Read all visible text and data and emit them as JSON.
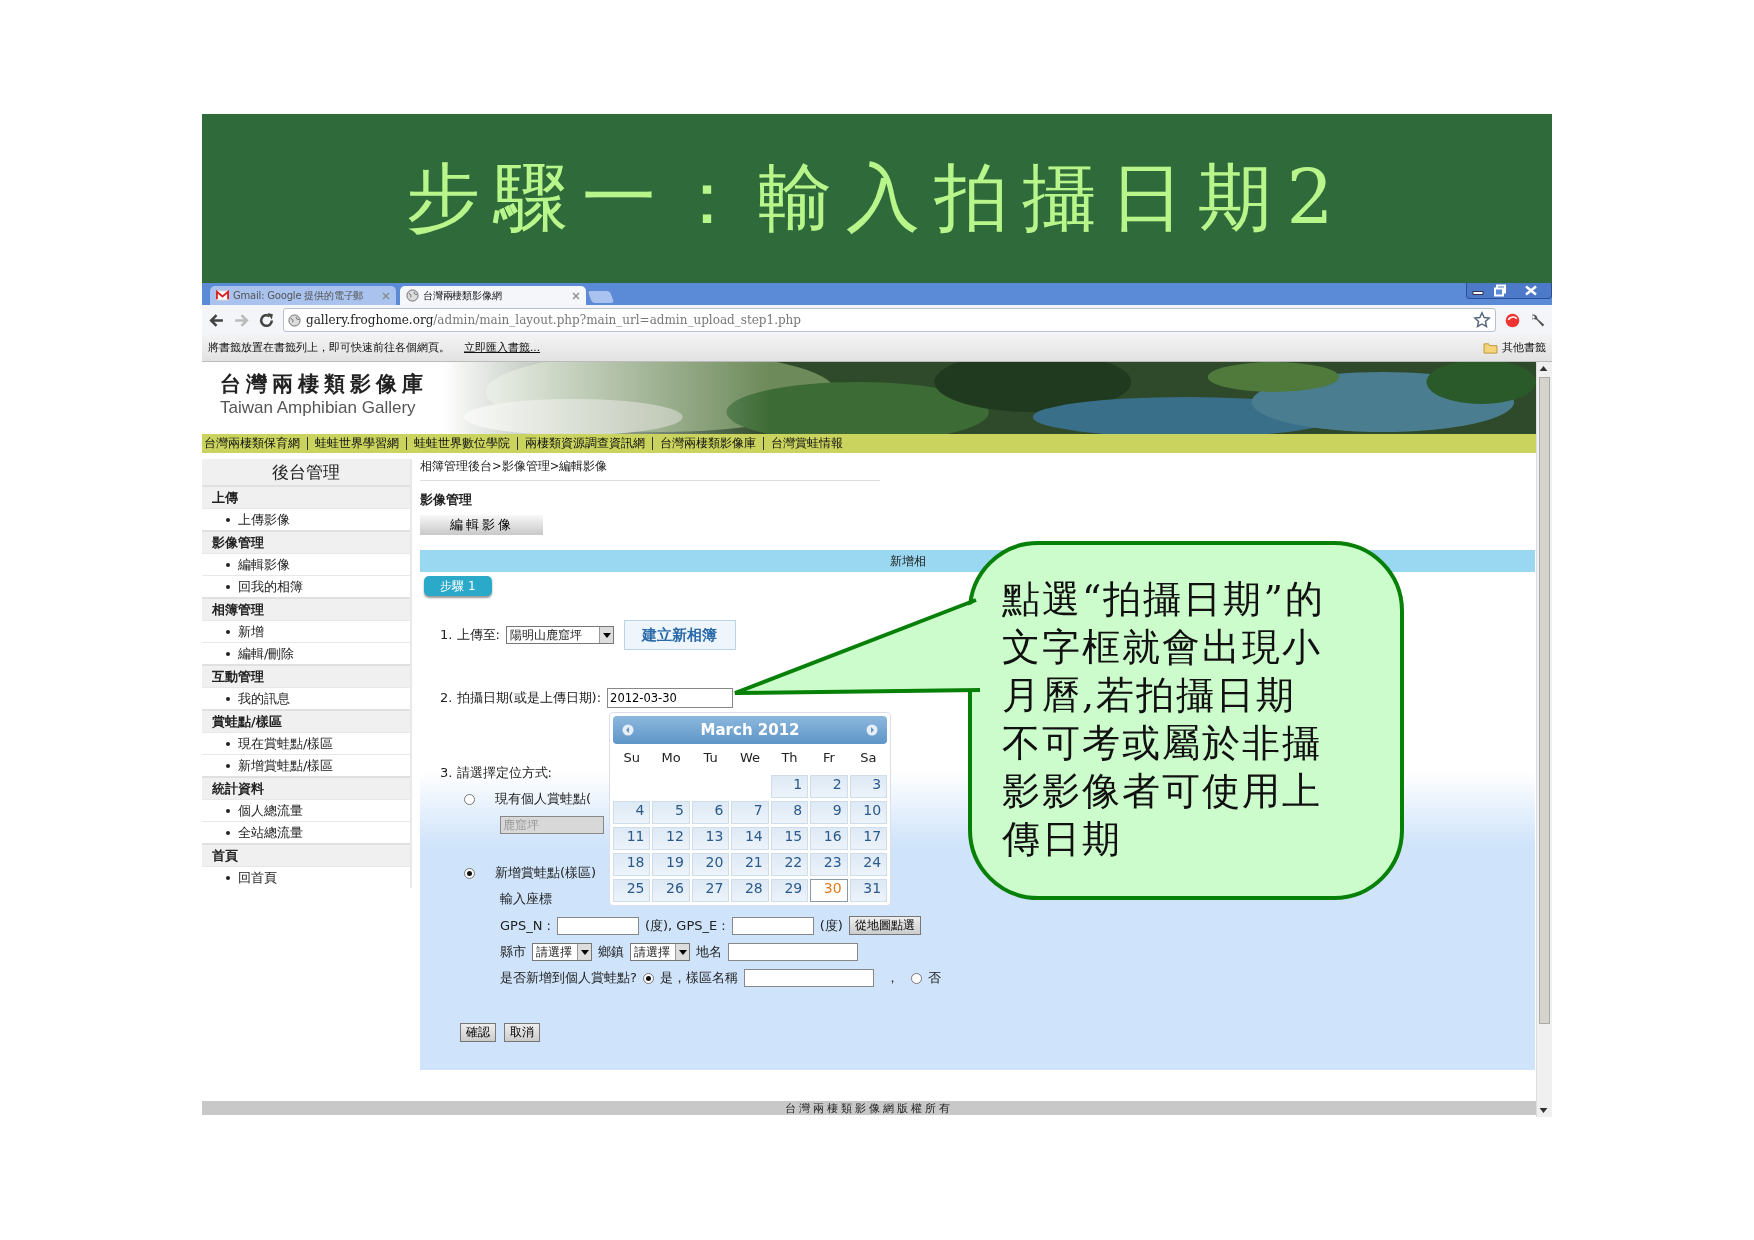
{
  "slide_title": "步驟一：輸入拍攝日期2",
  "browser": {
    "tabs": [
      {
        "title": "Gmail: Google 提供的電子郵",
        "kind": "mail",
        "selected": false
      },
      {
        "title": "台灣兩棲類影像網",
        "kind": "globe",
        "selected": true
      }
    ],
    "url_host": "gallery.froghome.org",
    "url_path": "/admin/main_layout.php?main_url=admin_upload_step1.php",
    "bookmark_prompt": "將書籤放置在書籤列上，即可快速前往各個網頁。",
    "bookmark_link": "立即匯入書籤...",
    "other_bookmarks": "其他書籤"
  },
  "site": {
    "title_zh": "台灣兩棲類影像庫",
    "title_en": "Taiwan Amphibian Gallery",
    "links": [
      "台灣兩棲類保育網",
      "蛙蛙世界學習網",
      "蛙蛙世界數位學院",
      "兩棲類資源調查資訊網",
      "台灣兩棲類影像庫",
      "台灣賞蛙情報"
    ]
  },
  "sidebar": {
    "title": "後台管理",
    "sections": [
      {
        "heading": "上傳",
        "items": [
          "上傳影像"
        ]
      },
      {
        "heading": "影像管理",
        "items": [
          "編輯影像",
          "回我的相簿"
        ]
      },
      {
        "heading": "相簿管理",
        "items": [
          "新增",
          "編輯/刪除"
        ]
      },
      {
        "heading": "互動管理",
        "items": [
          "我的訊息"
        ]
      },
      {
        "heading": "賞蛙點/樣區",
        "items": [
          "現在賞蛙點/樣區",
          "新增賞蛙點/樣區"
        ]
      },
      {
        "heading": "統計資料",
        "items": [
          "個人總流量",
          "全站總流量"
        ]
      },
      {
        "heading": "首頁",
        "items": [
          "回首頁"
        ]
      }
    ]
  },
  "breadcrumb": "相簿管理後台>影像管理>編輯影像",
  "section_title": "影像管理",
  "edit_button": "編輯影像",
  "panel_title": "新增相",
  "step_tab": "步驟 1",
  "form": {
    "upload_label": "1. 上傳至:",
    "album": "陽明山鹿窟坪",
    "new_album_button": "建立新相簿",
    "date_label": "2. 拍攝日期(或是上傳日期):",
    "date_value": "2012-03-30",
    "locate_label": "3. 請選擇定位方式:",
    "options": [
      {
        "label": "現有個人賞蛙點(",
        "selected": false
      },
      {
        "label": "新增賞蛙點(樣區)",
        "selected": true
      }
    ],
    "existing_spot": "鹿窟坪",
    "coords_label": "輸入座標",
    "gps_n_label": "GPS_N :",
    "gps_e_label": "(度), GPS_E :",
    "degree": "(度)",
    "map_button": "從地圖點選",
    "county_label": "縣市",
    "county": "請選擇",
    "town_label": "鄉鎮",
    "town": "請選擇",
    "place_label": "地名",
    "add_question": "是否新增到個人賞蛙點?",
    "add_choices": [
      {
        "label": "是，樣區名稱",
        "selected": true
      },
      {
        "label": "否",
        "selected": false
      }
    ],
    "comma": "，",
    "buttons": [
      "確認",
      "取消"
    ]
  },
  "calendar": {
    "title": "March 2012",
    "weekdays": [
      "Su",
      "Mo",
      "Tu",
      "We",
      "Th",
      "Fr",
      "Sa"
    ],
    "days": [
      {
        "kind": "blank"
      },
      {
        "kind": "blank"
      },
      {
        "kind": "blank"
      },
      {
        "kind": "blank"
      },
      {
        "kind": "day",
        "d": "1",
        "selected": false
      },
      {
        "kind": "day",
        "d": "2",
        "selected": false
      },
      {
        "kind": "day",
        "d": "3",
        "selected": false
      },
      {
        "kind": "day",
        "d": "4",
        "selected": false
      },
      {
        "kind": "day",
        "d": "5",
        "selected": false
      },
      {
        "kind": "day",
        "d": "6",
        "selected": false
      },
      {
        "kind": "day",
        "d": "7",
        "selected": false
      },
      {
        "kind": "day",
        "d": "8",
        "selected": false
      },
      {
        "kind": "day",
        "d": "9",
        "selected": false
      },
      {
        "kind": "day",
        "d": "10",
        "selected": false
      },
      {
        "kind": "day",
        "d": "11",
        "selected": false
      },
      {
        "kind": "day",
        "d": "12",
        "selected": false
      },
      {
        "kind": "day",
        "d": "13",
        "selected": false
      },
      {
        "kind": "day",
        "d": "14",
        "selected": false
      },
      {
        "kind": "day",
        "d": "15",
        "selected": false
      },
      {
        "kind": "day",
        "d": "16",
        "selected": false
      },
      {
        "kind": "day",
        "d": "17",
        "selected": false
      },
      {
        "kind": "day",
        "d": "18",
        "selected": false
      },
      {
        "kind": "day",
        "d": "19",
        "selected": false
      },
      {
        "kind": "day",
        "d": "20",
        "selected": false
      },
      {
        "kind": "day",
        "d": "21",
        "selected": false
      },
      {
        "kind": "day",
        "d": "22",
        "selected": false
      },
      {
        "kind": "day",
        "d": "23",
        "selected": false
      },
      {
        "kind": "day",
        "d": "24",
        "selected": false
      },
      {
        "kind": "day",
        "d": "25",
        "selected": false
      },
      {
        "kind": "day",
        "d": "26",
        "selected": false
      },
      {
        "kind": "day",
        "d": "27",
        "selected": false
      },
      {
        "kind": "day",
        "d": "28",
        "selected": false
      },
      {
        "kind": "day",
        "d": "29",
        "selected": false
      },
      {
        "kind": "day",
        "d": "30",
        "selected": true
      },
      {
        "kind": "day",
        "d": "31",
        "selected": false
      }
    ]
  },
  "callout": [
    "點選“拍攝日期”的",
    "文字框就會出現小",
    "月曆,若拍攝日期",
    "不可考或屬於非攝",
    "影影像者可使用上",
    "傳日期"
  ],
  "footer": "台灣兩棲類影像網版權所有"
}
